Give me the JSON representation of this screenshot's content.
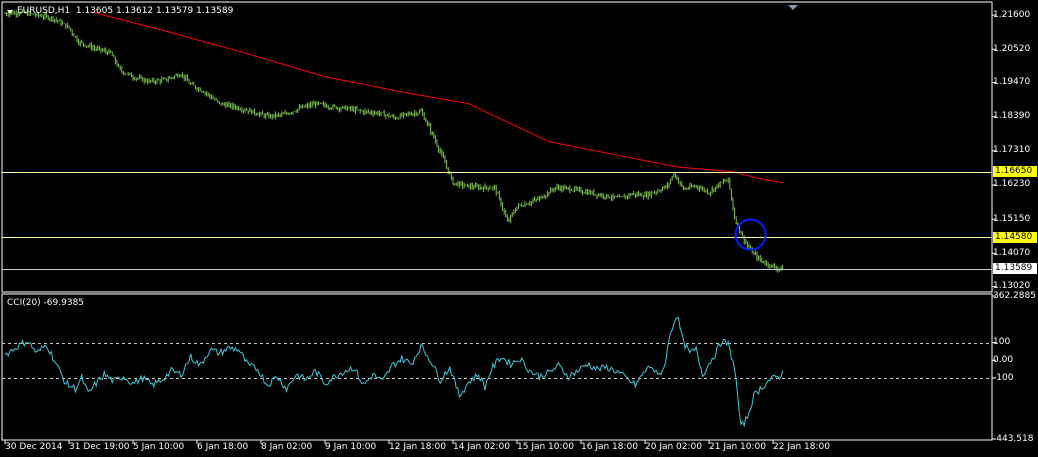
{
  "header": {
    "symbol": "EURUSD,H1",
    "ohlc": "1.13605 1.13612 1.13579 1.13589"
  },
  "indicator_header": "CCI(20) -69.9385",
  "colors": {
    "background": "#000000",
    "bars": "#7ec850",
    "moving_average": "#ff0000",
    "cci_line": "#40c8d8",
    "hlines": "#ffffa0",
    "level_tag": "#ffff00",
    "circle": "#0020ff"
  },
  "chart_data": [
    {
      "type": "bar",
      "name": "EURUSD,H1 price (OHLC bars)",
      "price_axis_labels": [
        "1.21600",
        "1.20520",
        "1.19470",
        "1.18390",
        "1.17310",
        "1.16230",
        "1.15150",
        "1.14070",
        "1.13020"
      ],
      "ylim": [
        1.1288,
        1.2195
      ],
      "x_tick_labels": [
        "30 Dec 2014",
        "31 Dec 19:00",
        "5 Jan 10:00",
        "6 Jan 18:00",
        "8 Jan 02:00",
        "9 Jan 10:00",
        "12 Jan 18:00",
        "14 Jan 02:00",
        "15 Jan 10:00",
        "16 Jan 18:00",
        "20 Jan 02:00",
        "21 Jan 10:00",
        "22 Jan 18:00"
      ],
      "horizontal_levels": [
        {
          "value": 1.1665,
          "label": "1.16650",
          "highlight": true
        },
        {
          "value": 1.1458,
          "label": "1.14580",
          "highlight": true
        },
        {
          "value": 1.13589,
          "label": "1.13589",
          "highlight": false
        }
      ],
      "close_path": [
        [
          0,
          1.2165
        ],
        [
          10,
          1.2168
        ],
        [
          20,
          1.216
        ],
        [
          30,
          1.215
        ],
        [
          40,
          1.212
        ],
        [
          46,
          1.2075
        ],
        [
          56,
          1.2055
        ],
        [
          66,
          1.204
        ],
        [
          72,
          1.1985
        ],
        [
          80,
          1.1965
        ],
        [
          90,
          1.195
        ],
        [
          100,
          1.1955
        ],
        [
          110,
          1.1975
        ],
        [
          116,
          1.194
        ],
        [
          124,
          1.192
        ],
        [
          134,
          1.188
        ],
        [
          144,
          1.187
        ],
        [
          154,
          1.1855
        ],
        [
          164,
          1.184
        ],
        [
          174,
          1.1845
        ],
        [
          184,
          1.1865
        ],
        [
          194,
          1.188
        ],
        [
          204,
          1.187
        ],
        [
          214,
          1.1865
        ],
        [
          224,
          1.1855
        ],
        [
          234,
          1.185
        ],
        [
          244,
          1.1835
        ],
        [
          250,
          1.1845
        ],
        [
          260,
          1.1855
        ],
        [
          266,
          1.1795
        ],
        [
          274,
          1.1705
        ],
        [
          280,
          1.163
        ],
        [
          288,
          1.162
        ],
        [
          298,
          1.1615
        ],
        [
          306,
          1.1615
        ],
        [
          310,
          1.1565
        ],
        [
          314,
          1.1505
        ],
        [
          320,
          1.1555
        ],
        [
          326,
          1.1565
        ],
        [
          334,
          1.158
        ],
        [
          344,
          1.1615
        ],
        [
          354,
          1.161
        ],
        [
          364,
          1.16
        ],
        [
          374,
          1.159
        ],
        [
          384,
          1.158
        ],
        [
          392,
          1.1595
        ],
        [
          400,
          1.159
        ],
        [
          408,
          1.1605
        ],
        [
          414,
          1.162
        ],
        [
          418,
          1.166
        ],
        [
          424,
          1.161
        ],
        [
          432,
          1.162
        ],
        [
          440,
          1.16
        ],
        [
          446,
          1.1625
        ],
        [
          452,
          1.164
        ],
        [
          456,
          1.152
        ],
        [
          460,
          1.147
        ],
        [
          464,
          1.143
        ],
        [
          468,
          1.1405
        ],
        [
          472,
          1.1385
        ],
        [
          478,
          1.137
        ],
        [
          482,
          1.136
        ],
        [
          486,
          1.1359
        ]
      ],
      "moving_average_path": [
        [
          54,
          1.217
        ],
        [
          100,
          1.211
        ],
        [
          150,
          1.204
        ],
        [
          200,
          1.1965
        ],
        [
          250,
          1.1915
        ],
        [
          290,
          1.188
        ],
        [
          300,
          1.1855
        ],
        [
          340,
          1.176
        ],
        [
          380,
          1.172
        ],
        [
          420,
          1.168
        ],
        [
          455,
          1.1665
        ],
        [
          470,
          1.1645
        ],
        [
          486,
          1.163
        ]
      ],
      "marker_circle": {
        "bar": 466,
        "price": 1.1466
      },
      "bar_count": 487
    },
    {
      "type": "line",
      "name": "CCI(20)",
      "current_value": -69.9385,
      "y_tick_labels": [
        "362.2885",
        "100",
        "0.00",
        "-100",
        "-443.518"
      ],
      "ylim": [
        -443.518,
        362.2885
      ],
      "levels": [
        100,
        -100
      ],
      "points": [
        [
          0,
          30
        ],
        [
          8,
          80
        ],
        [
          14,
          110
        ],
        [
          20,
          40
        ],
        [
          26,
          90
        ],
        [
          32,
          -20
        ],
        [
          38,
          -130
        ],
        [
          44,
          -160
        ],
        [
          48,
          -100
        ],
        [
          52,
          -190
        ],
        [
          56,
          -140
        ],
        [
          62,
          -80
        ],
        [
          68,
          -120
        ],
        [
          74,
          -90
        ],
        [
          80,
          -130
        ],
        [
          86,
          -100
        ],
        [
          92,
          -140
        ],
        [
          98,
          -110
        ],
        [
          104,
          -60
        ],
        [
          110,
          -80
        ],
        [
          116,
          20
        ],
        [
          122,
          -30
        ],
        [
          128,
          60
        ],
        [
          134,
          40
        ],
        [
          140,
          70
        ],
        [
          146,
          60
        ],
        [
          152,
          -30
        ],
        [
          158,
          -50
        ],
        [
          164,
          -140
        ],
        [
          170,
          -90
        ],
        [
          176,
          -160
        ],
        [
          182,
          -80
        ],
        [
          188,
          -110
        ],
        [
          194,
          -60
        ],
        [
          200,
          -130
        ],
        [
          206,
          -90
        ],
        [
          212,
          -60
        ],
        [
          218,
          -40
        ],
        [
          224,
          -140
        ],
        [
          230,
          -80
        ],
        [
          236,
          -120
        ],
        [
          242,
          -30
        ],
        [
          248,
          10
        ],
        [
          254,
          -20
        ],
        [
          260,
          80
        ],
        [
          266,
          0
        ],
        [
          272,
          -110
        ],
        [
          278,
          -40
        ],
        [
          284,
          -200
        ],
        [
          290,
          -120
        ],
        [
          296,
          -80
        ],
        [
          300,
          -150
        ],
        [
          304,
          -50
        ],
        [
          310,
          20
        ],
        [
          316,
          -20
        ],
        [
          322,
          10
        ],
        [
          328,
          -60
        ],
        [
          334,
          -90
        ],
        [
          340,
          -70
        ],
        [
          346,
          -30
        ],
        [
          352,
          -90
        ],
        [
          358,
          -60
        ],
        [
          364,
          -20
        ],
        [
          370,
          -50
        ],
        [
          376,
          -40
        ],
        [
          382,
          -60
        ],
        [
          388,
          -100
        ],
        [
          394,
          -140
        ],
        [
          400,
          -60
        ],
        [
          404,
          -30
        ],
        [
          408,
          -90
        ],
        [
          412,
          -40
        ],
        [
          416,
          160
        ],
        [
          420,
          260
        ],
        [
          424,
          100
        ],
        [
          428,
          40
        ],
        [
          432,
          60
        ],
        [
          436,
          -80
        ],
        [
          440,
          -20
        ],
        [
          444,
          40
        ],
        [
          448,
          110
        ],
        [
          452,
          90
        ],
        [
          456,
          -40
        ],
        [
          460,
          -380
        ],
        [
          464,
          -320
        ],
        [
          468,
          -200
        ],
        [
          472,
          -160
        ],
        [
          478,
          -110
        ],
        [
          484,
          -90
        ],
        [
          486,
          -70
        ]
      ]
    }
  ]
}
